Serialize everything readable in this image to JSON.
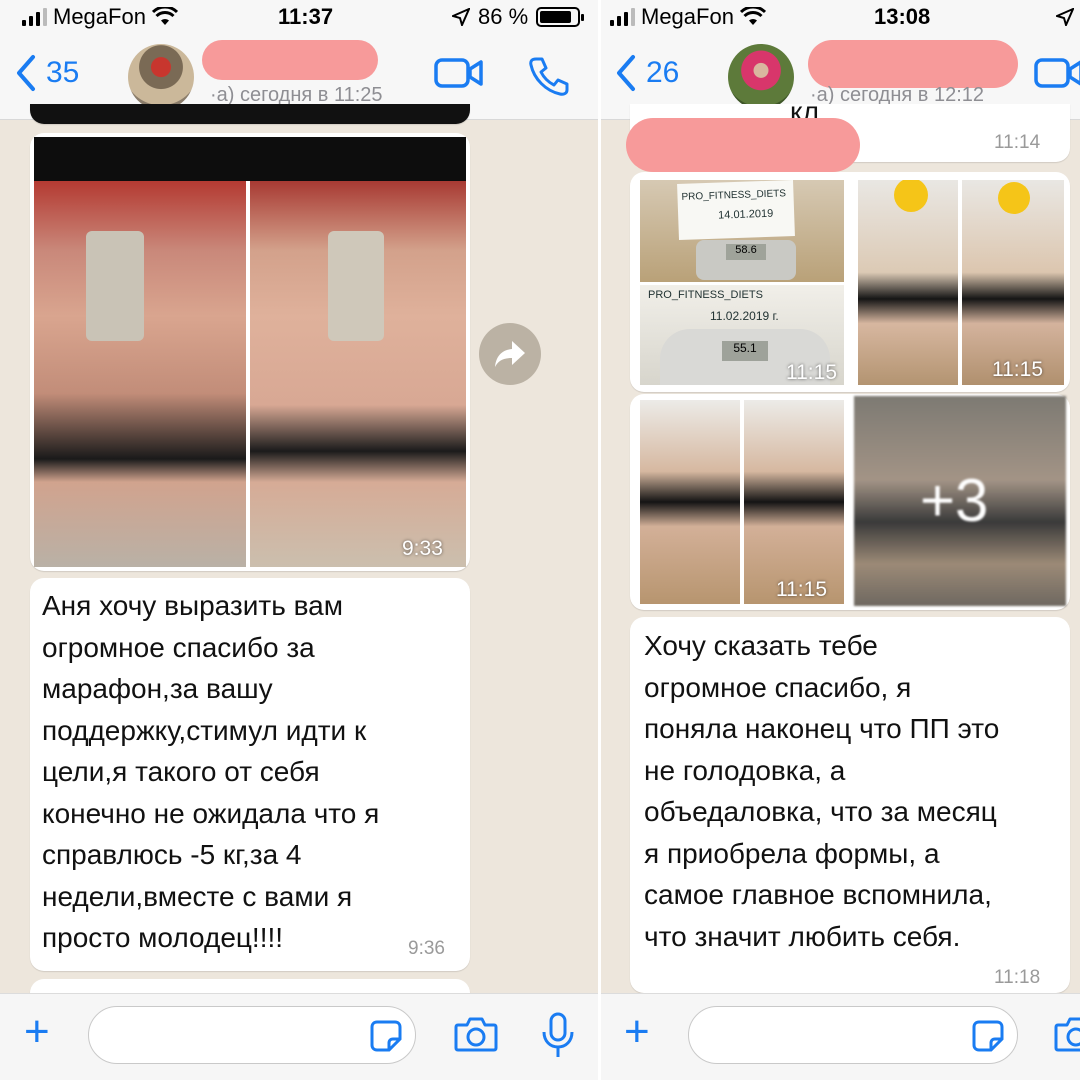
{
  "left": {
    "status": {
      "carrier": "MegaFon",
      "time": "11:37",
      "battery": "86 %",
      "battery_level": 0.86
    },
    "header": {
      "back_count": "35",
      "subtitle": "·а) сегодня в 11:25"
    },
    "messages": {
      "photo_time": "9:33",
      "text": [
        "Аня хочу выразить вам",
        "огромное спасибо за",
        "марафон,за вашу",
        "поддержку,стимул идти к",
        "цели,я такого от себя",
        "конечно не ожидала что я",
        "справлюсь -5 кг,за 4",
        "недели,вместе с вами я",
        "просто молодец!!!!"
      ],
      "text_time": "9:36"
    }
  },
  "right": {
    "status": {
      "carrier": "MegaFon",
      "time": "13:08"
    },
    "header": {
      "back_count": "26",
      "subtitle": "·а) сегодня в 12:12"
    },
    "messages": {
      "top_partial": "кл",
      "top_time": "11:14",
      "photo_labels": [
        "PRO_FITNESS_DIETS",
        "14.01.2019",
        "58.6",
        "PRO_FITNESS_DIETS",
        "11.02.2019 г.",
        "55.1"
      ],
      "photo_times": [
        "11:15",
        "11:15",
        "11:15"
      ],
      "more_count": "+3",
      "text": [
        "Хочу сказать тебе",
        "огромное спасибо, я",
        "поняла наконец что ПП это",
        "не голодовка, а",
        "объедаловка, что за месяц",
        "я приобрела формы, а",
        "самое главное вспомнила,",
        "что значит любить себя."
      ],
      "text_time": "11:18"
    }
  },
  "colors": {
    "accent": "#1a7cf2",
    "bubble": "#ffffff",
    "chat_bg": "#ede6dc",
    "redaction": "#f79a9a"
  },
  "icons": [
    "back-chevron-icon",
    "video-call-icon",
    "phone-icon",
    "forward-icon",
    "plus-icon",
    "sticker-icon",
    "camera-icon",
    "microphone-icon",
    "wifi-icon",
    "location-arrow-icon"
  ]
}
